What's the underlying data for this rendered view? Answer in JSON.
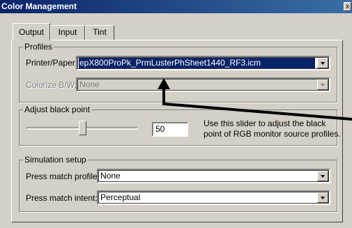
{
  "window": {
    "title": "Color Management",
    "close_glyph": "x"
  },
  "tabs": [
    {
      "label": "Output",
      "active": true
    },
    {
      "label": "Input",
      "active": false
    },
    {
      "label": "Tint",
      "active": false
    }
  ],
  "profiles": {
    "group_title": "Profiles",
    "printer_paper_label": "Printer/Paper:",
    "printer_paper_value": "epX800ProPk_PrmLusterPhSheet1440_RF3.icm",
    "colorize_label": "Colorize B/W:",
    "colorize_value": "None"
  },
  "black_point": {
    "group_title": "Adjust black point",
    "slider_level_fraction": 0.5,
    "value": "50",
    "help_text": "Use this slider to adjust the black point of RGB monitor source profiles."
  },
  "simulation": {
    "group_title": "Simulation setup",
    "press_profile_label": "Press match profile:",
    "press_profile_value": "None",
    "press_intent_label": "Press match intent:",
    "press_intent_value": "Perceptual"
  },
  "colors": {
    "titlebar": "#0a246a",
    "face": "#d4d0c8",
    "annotation_arrow": "#000000"
  }
}
